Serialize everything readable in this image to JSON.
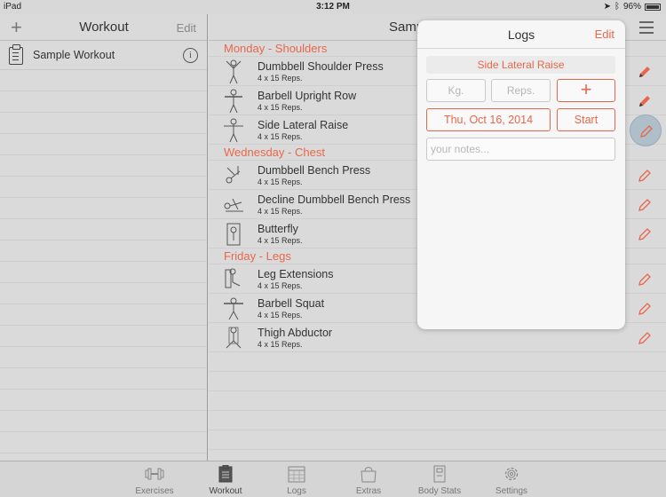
{
  "status_bar": {
    "device": "iPad",
    "time": "3:12 PM",
    "battery": "96%"
  },
  "left_pane": {
    "title": "Workout",
    "edit_label": "Edit",
    "items": [
      {
        "label": "Sample Workout"
      }
    ]
  },
  "right_pane": {
    "title": "Samp",
    "sections": [
      {
        "title": "Monday - Shoulders",
        "exercises": [
          {
            "name": "Dumbbell Shoulder Press",
            "reps": "4 x 15 Reps."
          },
          {
            "name": "Barbell Upright Row",
            "reps": "4 x 15 Reps."
          },
          {
            "name": "Side Lateral Raise",
            "reps": "4 x 15 Reps."
          }
        ]
      },
      {
        "title": "Wednesday - Chest",
        "exercises": [
          {
            "name": "Dumbbell Bench Press",
            "reps": "4 x 15 Reps."
          },
          {
            "name": "Decline Dumbbell Bench Press",
            "reps": "4 x 15 Reps."
          },
          {
            "name": "Butterfly",
            "reps": "4 x 15 Reps."
          }
        ]
      },
      {
        "title": "Friday - Legs",
        "exercises": [
          {
            "name": "Leg Extensions",
            "reps": "4 x 15 Reps."
          },
          {
            "name": "Barbell Squat",
            "reps": "4 x 15 Reps."
          },
          {
            "name": "Thigh Abductor",
            "reps": "4 x 15 Reps."
          }
        ]
      }
    ]
  },
  "logs_popover": {
    "title": "Logs",
    "edit_label": "Edit",
    "exercise": "Side Lateral Raise",
    "kg_placeholder": "Kg.",
    "reps_placeholder": "Reps.",
    "add_label": "+",
    "date": "Thu, Oct 16, 2014",
    "start_label": "Start",
    "notes_placeholder": "your notes..."
  },
  "tabbar": {
    "tabs": [
      {
        "label": "Exercises",
        "icon": "dumbbell-icon"
      },
      {
        "label": "Workout",
        "icon": "clipboard-icon",
        "active": true
      },
      {
        "label": "Logs",
        "icon": "calendar-icon"
      },
      {
        "label": "Extras",
        "icon": "bag-icon"
      },
      {
        "label": "Body Stats",
        "icon": "scale-icon"
      },
      {
        "label": "Settings",
        "icon": "gear-icon"
      }
    ]
  },
  "colors": {
    "accent": "#e8674a",
    "background": "#dadada"
  }
}
